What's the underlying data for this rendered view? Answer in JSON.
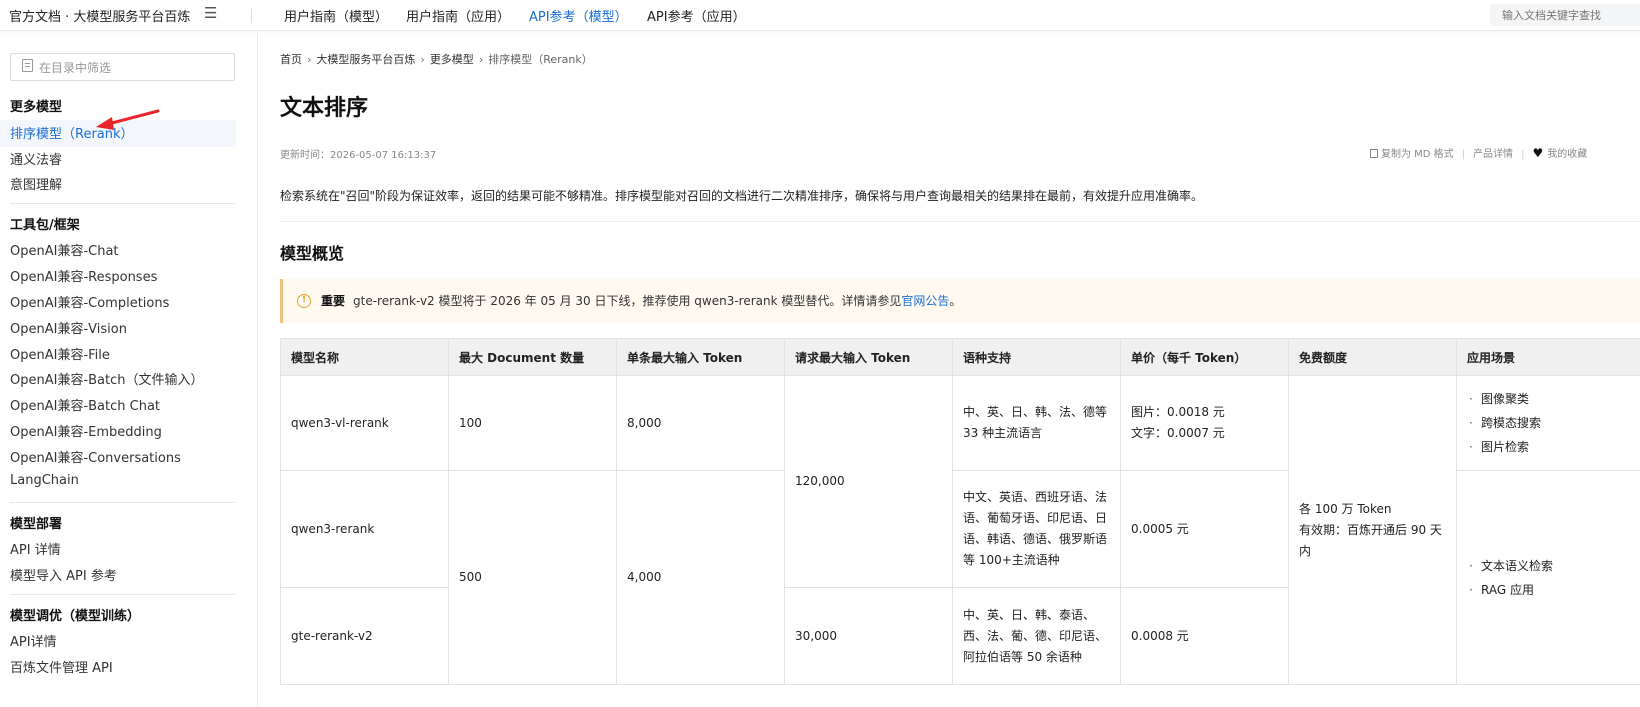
{
  "header": {
    "brand": "官方文档 · 大模型服务平台百炼",
    "menu_icon": "menu-icon",
    "tabs": [
      {
        "label": "用户指南（模型）",
        "active": false
      },
      {
        "label": "用户指南（应用）",
        "active": false
      },
      {
        "label": "API参考（模型）",
        "active": true
      },
      {
        "label": "API参考（应用）",
        "active": false
      }
    ],
    "search_placeholder": "输入文档关键字查找"
  },
  "sidebar": {
    "filter_placeholder": "在目录中筛选",
    "groups": [
      {
        "title": "更多模型",
        "items": [
          {
            "label": "排序模型（Rerank）",
            "active": true
          },
          {
            "label": "通义法睿"
          },
          {
            "label": "意图理解"
          }
        ]
      },
      {
        "title": "工具包/框架",
        "items": [
          {
            "label": "OpenAI兼容-Chat"
          },
          {
            "label": "OpenAI兼容-Responses"
          },
          {
            "label": "OpenAI兼容-Completions"
          },
          {
            "label": "OpenAI兼容-Vision"
          },
          {
            "label": "OpenAI兼容-File"
          },
          {
            "label": "OpenAI兼容-Batch（文件输入）"
          },
          {
            "label": "OpenAI兼容-Batch Chat"
          },
          {
            "label": "OpenAI兼容-Embedding"
          },
          {
            "label": "OpenAI兼容-Conversations"
          },
          {
            "label": "LangChain"
          }
        ]
      },
      {
        "title": "模型部署",
        "items": [
          {
            "label": "API 详情"
          },
          {
            "label": "模型导入 API 参考"
          }
        ]
      },
      {
        "title": "模型调优（模型训练）",
        "items": [
          {
            "label": "API详情"
          },
          {
            "label": "百炼文件管理 API"
          }
        ]
      }
    ],
    "annotation_color": "#e8262b"
  },
  "breadcrumb": [
    "首页",
    "大模型服务平台百炼",
    "更多模型",
    "排序模型（Rerank）"
  ],
  "page": {
    "title": "文本排序",
    "updated": "更新时间：2026-05-07 16:13:37",
    "tools": {
      "copy_md": "复制为 MD 格式",
      "product": "产品详情",
      "favorite": "我的收藏"
    },
    "intro": "检索系统在\"召回\"阶段为保证效率，返回的结果可能不够精准。排序模型能对召回的文档进行二次精准排序，确保将与用户查询最相关的结果排在最前，有效提升应用准确率。",
    "section_title": "模型概览",
    "notice": {
      "label": "重要",
      "text": "gte-rerank-v2 模型将于 2026 年 05 月 30 日下线，推荐使用 qwen3-rerank 模型替代。详情请参见",
      "link": "官网公告",
      "end": "。"
    }
  },
  "table": {
    "headers": [
      "模型名称",
      "最大 Document 数量",
      "单条最大输入 Token",
      "请求最大输入 Token",
      "语种支持",
      "单价（每千 Token）",
      "免费额度",
      "应用场景"
    ],
    "rows": [
      {
        "name": "qwen3-vl-rerank",
        "max_docs": "100",
        "single_token": "8,000",
        "lang": "中、英、日、韩、法、德等 33 种主流语言",
        "price": [
          "图片：0.0018 元",
          "文字：0.0007 元"
        ]
      },
      {
        "name": "qwen3-rerank",
        "lang": "中文、英语、西班牙语、法语、葡萄牙语、印尼语、日语、韩语、德语、俄罗斯语等 100+主流语种",
        "price": [
          "0.0005 元"
        ]
      },
      {
        "name": "gte-rerank-v2",
        "request_token": "30,000",
        "lang": "中、英、日、韩、泰语、西、法、葡、德、印尼语、阿拉伯语等 50 余语种",
        "price": [
          "0.0008 元"
        ]
      }
    ],
    "merged": {
      "max_docs_2_3": "500",
      "single_token_2_3": "4,000",
      "request_token_1_2": "120,000",
      "free_quota": [
        "各 100 万 Token",
        "有效期：百炼开通后 90 天内"
      ],
      "scenes_1": [
        "图像聚类",
        "跨模态搜索",
        "图片检索"
      ],
      "scenes_2_3": [
        "文本语义检索",
        "RAG 应用"
      ]
    }
  }
}
